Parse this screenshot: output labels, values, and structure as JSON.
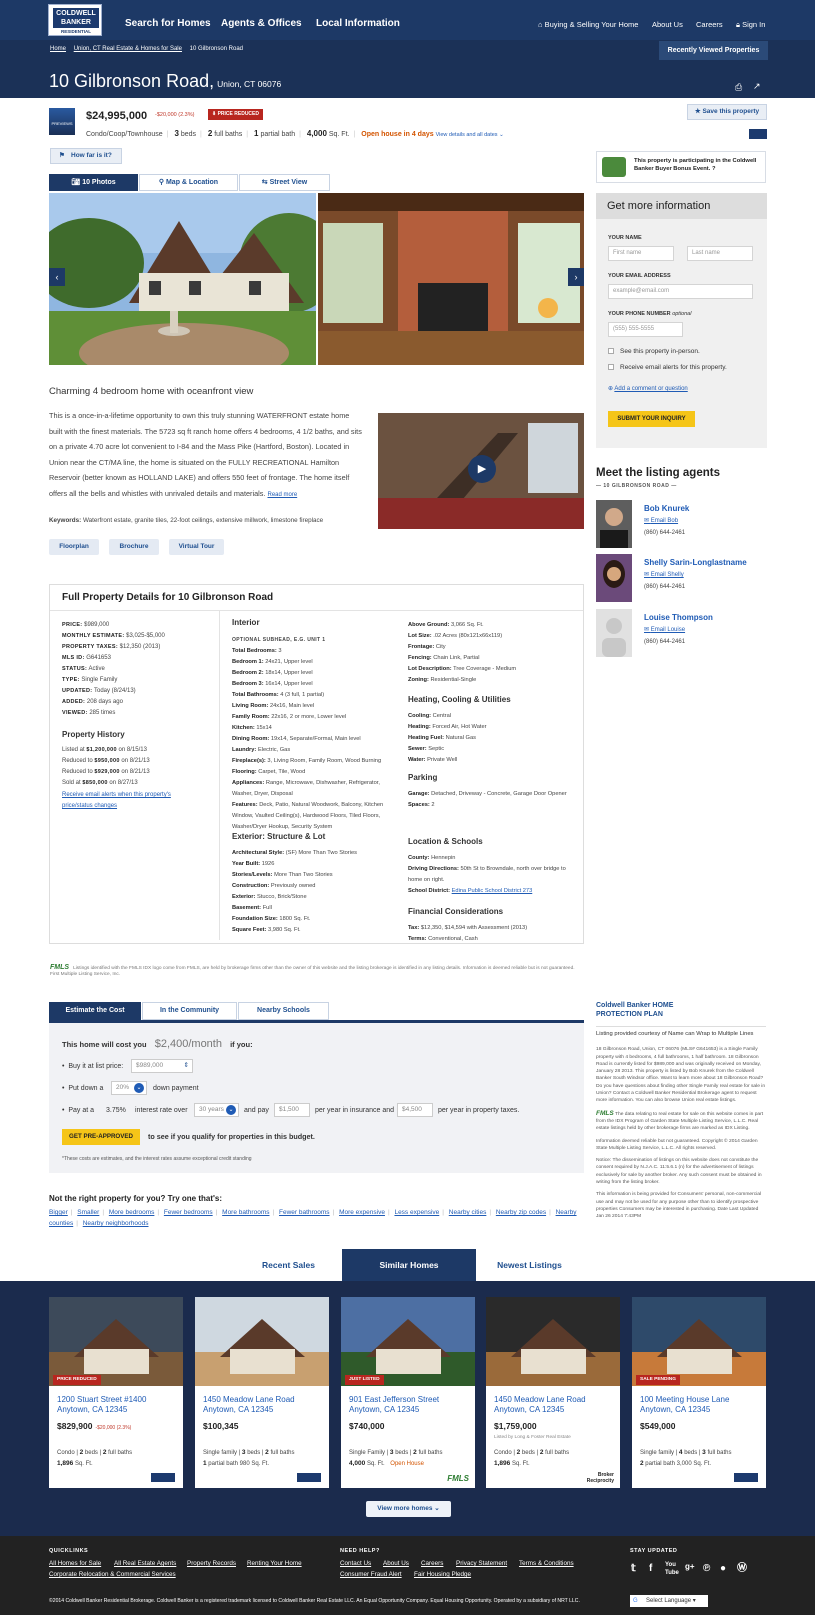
{
  "header": {
    "logo_line1": "COLDWELL BANKER",
    "logo_line2": "RESIDENTIAL BROKERAGE",
    "nav": [
      "Search for Homes",
      "Agents & Offices",
      "Local Information"
    ],
    "util": [
      "Buying & Selling Your Home",
      "About Us",
      "Careers",
      "Sign In"
    ]
  },
  "breadcrumb": [
    "Home",
    "Union, CT Real Estate & Homes for Sale",
    "10 Gilbronson Road"
  ],
  "recently_viewed": "Recently Viewed Properties",
  "address": {
    "street": "10 Gilbronson Road,",
    "city": "Union, CT 06076"
  },
  "listing": {
    "thumb_label": "PREVIEWS",
    "price": "$24,995,000",
    "price_change": "-$20,000 (2.3%)",
    "badge": "PRICE REDUCED",
    "save": "Save this property",
    "type": "Condo/Coop/Townhouse",
    "beds_n": "3",
    "beds_l": "beds",
    "baths_n": "2",
    "baths_l": "full baths",
    "pbath_n": "1",
    "pbath_l": "partial bath",
    "sqft_n": "4,000",
    "sqft_l": "Sq. Ft.",
    "open_house": "Open house in 4 days",
    "view_details": "View details and all dates",
    "how_far": "How far is it?"
  },
  "photo_tabs": [
    "10 Photos",
    "Map & Location",
    "Street View"
  ],
  "description": {
    "title": "Charming 4 bedroom home with oceanfront view",
    "body": "This is a once-in-a-lifetime opportunity to own this truly stunning WATERFRONT estate home built with the finest materials. The 5723 sq ft ranch home offers 4 bedrooms, 4 1/2 baths, and sits on a private 4.70 acre lot convenient to I-84 and the Mass Pike (Hartford, Boston). Located in Union near the CT/MA line, the home is situated on the FULLY RECREATIONAL Hamilton Reservoir (better known as HOLLAND LAKE) and offers 550 feet of frontage. The home itself offers all the bells and whistles with unrivaled details and materials.",
    "read_more": "Read more",
    "kw_label": "Keywords:",
    "keywords": "Waterfront estate, granite tiles, 22-foot ceilings, extensive millwork, limestone fireplace",
    "buttons": [
      "Floorplan",
      "Brochure",
      "Virtual Tour"
    ]
  },
  "bonus": "This property is participating in the Coldwell Banker Buyer Bonus Event.",
  "form": {
    "title": "Get more information",
    "name_label": "YOUR NAME",
    "first_ph": "First name",
    "last_ph": "Last name",
    "email_label": "YOUR EMAIL ADDRESS",
    "email_ph": "example@email.com",
    "phone_label": "YOUR PHONE NUMBER",
    "phone_opt": "optional",
    "phone_ph": "(555) 555-5555",
    "check1": "See this property in-person.",
    "check2": "Receive email alerts for this property.",
    "comment": "Add a comment or question",
    "submit": "SUBMIT YOUR INQUIRY"
  },
  "agents": {
    "title": "Meet the listing agents",
    "sub": "— 10 GILBRONSON ROAD —",
    "list": [
      {
        "name": "Bob Knurek",
        "email": "Email Bob",
        "phone": "(860) 644-2461"
      },
      {
        "name": "Shelly Sarin-Longlastname",
        "email": "Email Shelly",
        "phone": "(860) 644-2461"
      },
      {
        "name": "Louise Thompson",
        "email": "Email Louise",
        "phone": "(860) 644-2461"
      }
    ]
  },
  "details": {
    "title": "Full Property Details for 10 Gilbronson Road",
    "summary": [
      [
        "PRICE:",
        "$989,000"
      ],
      [
        "MONTHLY ESTIMATE:",
        "$3,025-$5,000"
      ],
      [
        "PROPERTY TAXES:",
        "$12,350 (2013)"
      ],
      [
        "MLS ID:",
        "G641653"
      ],
      [
        "STATUS:",
        "Active"
      ],
      [
        "TYPE:",
        "Single Family"
      ],
      [
        "UPDATED:",
        "Today (8/24/13)"
      ],
      [
        "ADDED:",
        "208 days ago"
      ],
      [
        "VIEWED:",
        "285 times"
      ]
    ],
    "history_title": "Property History",
    "history": [
      [
        "Listed at ",
        "$1,200,000",
        " on 8/15/13"
      ],
      [
        "Reduced to ",
        "$950,000",
        " on 8/21/13"
      ],
      [
        "Reduced to ",
        "$929,000",
        " on 8/21/13"
      ],
      [
        "Sold at ",
        "$850,000",
        " on 8/27/13"
      ]
    ],
    "alert_link": "Receive email alerts when this property's price/status changes",
    "interior_title": "Interior",
    "interior_sub": "OPTIONAL SUBHEAD, E.G. UNIT 1",
    "interior": [
      [
        "Total Bedrooms:",
        "3"
      ],
      [
        "Bedroom 1:",
        "24x21, Upper level"
      ],
      [
        "Bedroom 2:",
        "18x14, Upper level"
      ],
      [
        "Bedroom 3:",
        "16x14, Upper level"
      ],
      [
        "Total Bathrooms:",
        "4 (3 full, 1 partial)"
      ],
      [
        "Living Room:",
        "24x16, Main level"
      ],
      [
        "Family Room:",
        "22x16, 2 or more, Lower level"
      ],
      [
        "Kitchen:",
        "15x14"
      ],
      [
        "Dining Room:",
        "19x14, Separate/Formal, Main level"
      ],
      [
        "Laundry:",
        "Electric, Gas"
      ],
      [
        "Fireplace(s):",
        "3, Living Room, Family Room, Wood Burning"
      ],
      [
        "Flooring:",
        "Carpet, Tile, Wood"
      ],
      [
        "Appliances:",
        "Range, Microwave, Dishwasher, Refrigerator, Washer, Dryer, Disposal"
      ],
      [
        "Features:",
        "Deck, Patio, Natural Woodwork, Balcony, Kitchen Window, Vaulted Ceiling(s), Hardwood Floors, Tiled Floors, Washer/Dryer Hookup, Security System"
      ]
    ],
    "exterior_title": "Exterior: Structure & Lot",
    "exterior": [
      [
        "Architectural Style:",
        "(SF) More Than Two Stories"
      ],
      [
        "Year Built:",
        "1926"
      ],
      [
        "Stories/Levels:",
        "More Than Two Stories"
      ],
      [
        "Construction:",
        "Previously owned"
      ],
      [
        "Exterior:",
        "Stucco, Brick/Stone"
      ],
      [
        "Basement:",
        "Full"
      ],
      [
        "Foundation Size:",
        "1800 Sq. Ft."
      ],
      [
        "Square Feet:",
        "3,980 Sq. Ft."
      ]
    ],
    "lot": [
      [
        "Above Ground:",
        "3,066 Sq. Ft."
      ],
      [
        "Lot Size:",
        ".02 Acres (80x121x66x119)"
      ],
      [
        "Frontage:",
        "City"
      ],
      [
        "Fencing:",
        "Chain Link, Partial"
      ],
      [
        "Lot Description:",
        "Tree Coverage - Medium"
      ],
      [
        "Zoning:",
        "Residential-Single"
      ]
    ],
    "heating_title": "Heating, Cooling & Utilities",
    "heating": [
      [
        "Cooling:",
        "Central"
      ],
      [
        "Heating:",
        "Forced Air, Hot Water"
      ],
      [
        "Heating Fuel:",
        "Natural Gas"
      ],
      [
        "Sewer:",
        "Septic"
      ],
      [
        "Water:",
        "Private Well"
      ]
    ],
    "parking_title": "Parking",
    "parking": [
      [
        "Garage:",
        "Detached, Driveway - Concrete, Garage Door Opener"
      ],
      [
        "Spaces:",
        "2"
      ]
    ],
    "location_title": "Location & Schools",
    "location": [
      [
        "County:",
        "Hennepin"
      ],
      [
        "Driving Directions:",
        "50th St to Browndale, north over bridge to home on right."
      ],
      [
        "School District:",
        "Edina Public School District 273"
      ]
    ],
    "financial_title": "Financial Considerations",
    "financial": [
      [
        "Tax:",
        "$12,350, $14,594 with Assessment (2013)"
      ],
      [
        "Terms:",
        "Conventional, Cash"
      ]
    ]
  },
  "fmls_note": {
    "logo": "FMLS",
    "text": "Listings identified with the FMLS IDX logo come from FMLS, are held by brokerage firms other than the owner of this website and the listing brokerage is identified in any listing details. Information is deemed reliable but is not guaranteed. First Multiple Listing Service, Inc."
  },
  "estimate": {
    "tabs": [
      "Estimate the Cost",
      "In the Community",
      "Nearby Schools"
    ],
    "cost_label": "This home will cost you",
    "cost": "$2,400/month",
    "cost_suffix": "if you:",
    "buy_label": "Buy it at list price:",
    "buy_val": "$989,000",
    "down_label": "Put down a",
    "down_val": "20%",
    "down_suffix": "down payment",
    "pay_label": "Pay at a",
    "rate": "3.75%",
    "rate_label": "interest rate over",
    "years": "30 years",
    "and_pay": "and pay",
    "ins_val": "$1,500",
    "ins_label": "per year in insurance and",
    "tax_val": "$4,500",
    "tax_label": "per year in property taxes.",
    "preapp": "GET PRE-APPROVED",
    "preapp_suffix": "to see if you qualify for properties in this budget.",
    "footnote": "*These costs are estimates, and the interest rates assume exceptional credit standing"
  },
  "not_right": {
    "title": "Not the right property for you? Try one that's:",
    "links": [
      "Bigger",
      "Smaller",
      "More bedrooms",
      "Fewer bedrooms",
      "More bathrooms",
      "Fewer bathrooms",
      "More expensive",
      "Less expensive",
      "Nearby cities",
      "Nearby zip codes",
      "Nearby counties",
      "Nearby neighborhoods"
    ]
  },
  "disclaimer": {
    "hpp": "Coldwell Banker HOME PROTECTION PLAN",
    "courtesy": "Listing provided courtesy of Name can Wrap to Multiple Lines",
    "p1": "18 Gilbronson Road, Union, CT 06076 (MLS# G641653) is a Single Family property with 4 bedrooms, 4 full bathrooms, 1 half bathroom. 18 Gilbronson Road is currently listed for $989,000 and was originally received on Monday, January 28 2013. This property is listed by Bob Knurek from the Coldwell Banker South Windsor office. Want to learn more about 18 Gilbronson Road? Do you have questions about finding other Single Family real estate for sale in Union? Contact a Coldwell Banker Residential Brokerage agent to request more information. You can also browse Union real estate listings.",
    "p2": "The data relating to real estate for sale on this website comes in part from the IDX Program of Garden State Multiple Listing Service, L.L.C. Real estate listings held by other brokerage firms are marked as IDX Listing.",
    "p3": "Information deemed reliable but not guaranteed. Copyright © 2014 Garden State Multiple Listing Service, L.L.C. All rights reserved.",
    "p4": "Notice: The dissemination of listings on this website does not constitute the consent required by N.J.A.C. 11:5.6.1 (n) for the advertisement of listings exclusively for sale by another broker. Any such consent must be obtained in writing from the listing broker.",
    "p5": "This information is being provided for Consumers' personal, non-commercial use and may not be used for any purpose other than to identify prospective properties Consumers may be interested in purchasing. Date Last Updated Jan 26 2014 7:43PM"
  },
  "listing_tabs": [
    "Recent Sales",
    "Similar Homes",
    "Newest Listings"
  ],
  "cards": [
    {
      "badge": "PRICE REDUCED",
      "addr": "1200 Stuart Street #1400 Anytown, CA 12345",
      "price": "$829,900",
      "change": "-$20,000 (2.3%)",
      "by": "",
      "l1a": "Condo",
      "l1b": "2",
      "l1c": "beds",
      "l1d": "2",
      "l1e": "full baths",
      "l2a": "1,896",
      "l2b": "Sq. Ft.",
      "oh": ""
    },
    {
      "badge": "",
      "addr": "1450 Meadow Lane Road Anytown, CA 12345",
      "price": "$100,345",
      "change": "",
      "by": "",
      "l1a": "Single family",
      "l1b": "3",
      "l1c": "beds",
      "l1d": "2",
      "l1e": "full baths",
      "l2a": "1",
      "l2b": "partial bath  980 Sq. Ft.",
      "oh": ""
    },
    {
      "badge": "JUST LISTED",
      "addr": "901 East Jefferson Street Anytown, CA 12345",
      "price": "$740,000",
      "change": "",
      "by": "",
      "l1a": "Single Family",
      "l1b": "3",
      "l1c": "beds",
      "l1d": "2",
      "l1e": "full baths",
      "l2a": "4,000",
      "l2b": "Sq. Ft.",
      "oh": "Open House"
    },
    {
      "badge": "",
      "addr": "1450 Meadow Lane Road Anytown, CA 12345",
      "price": "$1,759,000",
      "change": "",
      "by": "Listed by Long & Foster Real Estate",
      "l1a": "Condo",
      "l1b": "2",
      "l1c": "beds",
      "l1d": "2",
      "l1e": "full baths",
      "l2a": "1,896",
      "l2b": "Sq. Ft.",
      "oh": ""
    },
    {
      "badge": "SALE PENDING",
      "addr": "100 Meeting House Lane Anytown, CA 12345",
      "price": "$549,000",
      "change": "",
      "by": "",
      "l1a": "Single family",
      "l1b": "4",
      "l1c": "beds",
      "l1d": "3",
      "l1e": "full baths",
      "l2a": "2",
      "l2b": "partial bath  3,000 Sq. Ft.",
      "oh": ""
    }
  ],
  "card_logos": [
    "FMLS",
    "Broker Reciprocity"
  ],
  "view_more": "View more homes",
  "footer": {
    "quicklinks_h": "QUICKLINKS",
    "quicklinks": [
      "All Homes for Sale",
      "All Real Estate Agents",
      "Property Records",
      "Renting Your Home",
      "Corporate Relocation & Commercial Services"
    ],
    "help_h": "NEED HELP?",
    "help": [
      "Contact Us",
      "About Us",
      "Careers",
      "Privacy Statement",
      "Terms & Conditions",
      "Consumer Fraud Alert",
      "Fair Housing Pledge"
    ],
    "stay_h": "STAY UPDATED",
    "social": [
      "Twitter",
      "Facebook",
      "YouTube",
      "Google+",
      "Pinterest",
      "Blogger",
      "WordPress"
    ],
    "copyright": "©2014 Coldwell Banker Residential Brokerage. Coldwell Banker is a registered trademark licensed to Coldwell Banker Real Estate LLC. An Equal Opportunity Company.  Equal Housing Opportunity. Operated by a subsidiary of NRT LLC.",
    "language": "Select Language"
  },
  "colors": {
    "navy": "#1d3966",
    "dark_navy": "#1b2b4d",
    "accent_yellow": "#f5c518",
    "red": "#b8261f",
    "link": "#1f5bb5"
  }
}
